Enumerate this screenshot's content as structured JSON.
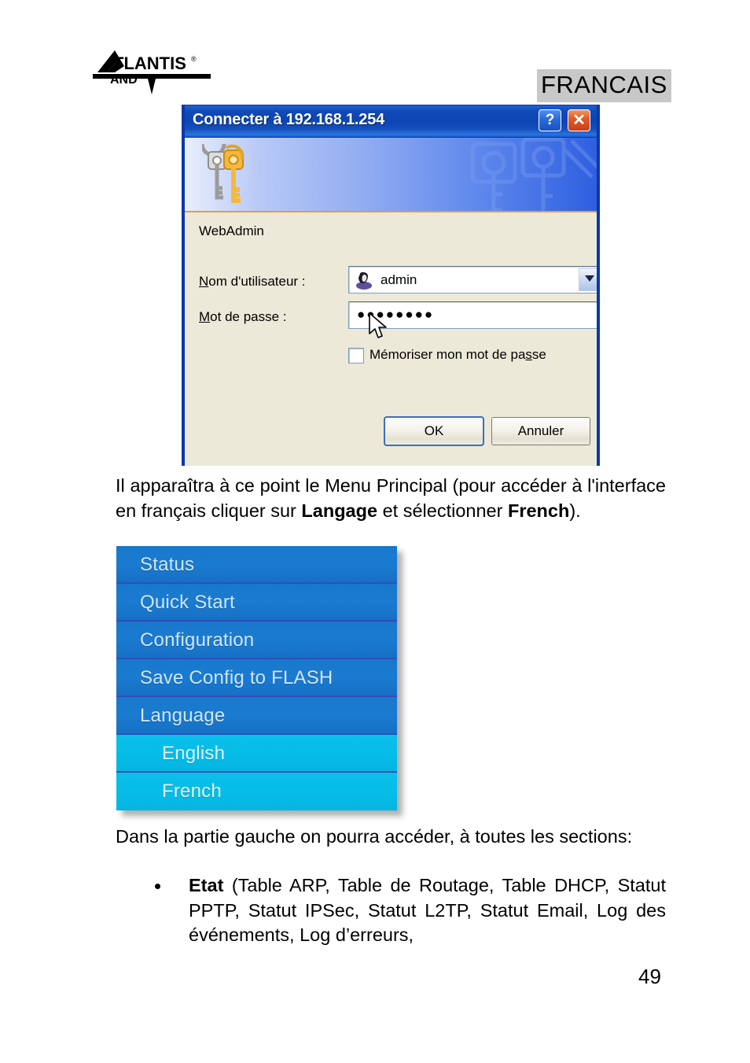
{
  "header": {
    "logo_main": "ATLANTIS",
    "logo_sub": "LAND",
    "logo_registered": "®",
    "language_tag": "FRANCAIS"
  },
  "dialog": {
    "title": "Connecter à 192.168.1.254",
    "help_button": "?",
    "close_button": "✕",
    "realm": "WebAdmin",
    "username": {
      "label_prefix": "",
      "label": "Nom d'utilisateur :",
      "value": "admin",
      "icon": "user-icon"
    },
    "password": {
      "label": "Mot de passe :",
      "value": "●●●●●●●●"
    },
    "remember": {
      "label": "Mémoriser mon mot de passe",
      "checked": false
    },
    "ok_label": "OK",
    "cancel_label": "Annuler"
  },
  "content": {
    "paragraph_1_part1": "Il apparaîtra à ce point le Menu Principal (pour accéder à l'interface en français cliquer sur ",
    "paragraph_1_bold1": "Langage",
    "paragraph_1_part2": " et sélectionner ",
    "paragraph_1_bold2": "French",
    "paragraph_1_part3": ").",
    "paragraph_2": "Dans la partie gauche on pourra accéder, à toutes les sections:",
    "bullet_1_bold": "Etat",
    "bullet_1_text": " (Table ARP, Table de Routage, Table DHCP, Statut PPTP, Statut IPSec, Statut L2TP, Statut Email, Log des événements,   Log d’erreurs,"
  },
  "router_menu": {
    "items": [
      {
        "label": "Status",
        "sub": false
      },
      {
        "label": "Quick Start",
        "sub": false
      },
      {
        "label": "Configuration",
        "sub": false
      },
      {
        "label": "Save Config to FLASH",
        "sub": false
      },
      {
        "label": "Language",
        "sub": false
      },
      {
        "label": "English",
        "sub": true
      },
      {
        "label": "French",
        "sub": true
      }
    ]
  },
  "footer": {
    "page_number": "49"
  },
  "colors": {
    "titlebar_blue": "#0d45b4",
    "menu_blue": "#1878cc",
    "menu_sub_cyan": "#06bde8",
    "close_red": "#e05c28",
    "banner_orange": "#e79c3c",
    "tag_gray": "#c8c8c8"
  }
}
